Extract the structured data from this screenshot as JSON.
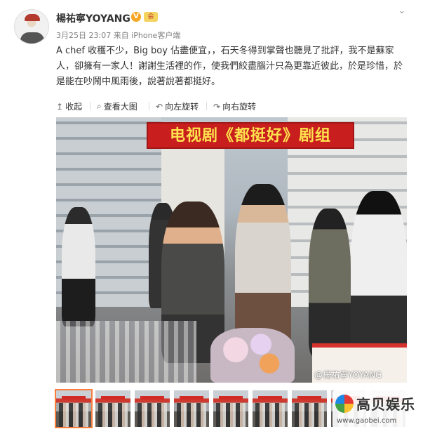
{
  "post": {
    "username": "楊祐寧YOYANG",
    "verified_badge": "V",
    "member_badge": "会",
    "meta": "3月25日 23:07 来自 iPhone客户端",
    "text": "A chef 收穫不少，Big boy 佔盡便宜，，石天冬得到掌聲也聽見了批評，我不是蘇家人，卻擁有一家人！謝謝生活裡的作，使我們絞盡腦汁只為更靠近彼此，於是珍惜，於是能在吵鬧中風雨後，說著說著都挺好。",
    "menu_icon": "chevron-down-icon"
  },
  "toolbar": {
    "collapse": {
      "label": "收起",
      "icon": "up-arrow-icon"
    },
    "view_large": {
      "label": "查看大图",
      "icon": "search-icon"
    },
    "rotate_left": {
      "label": "向左旋转",
      "icon": "rotate-left-icon"
    },
    "rotate_right": {
      "label": "向右旋转",
      "icon": "rotate-right-icon"
    }
  },
  "photo": {
    "banner_text": "电视剧《都挺好》剧组",
    "watermark": "@楊祐寧YOYANG"
  },
  "thumbnails": {
    "count": 9,
    "selected_index": 0
  },
  "logo": {
    "name": "高贝娱乐",
    "url": "www.gaobei.com"
  },
  "colors": {
    "accent": "#fa7d3c",
    "banner_red": "#c81e1e",
    "banner_text": "#ffe34d",
    "meta_gray": "#808080"
  }
}
